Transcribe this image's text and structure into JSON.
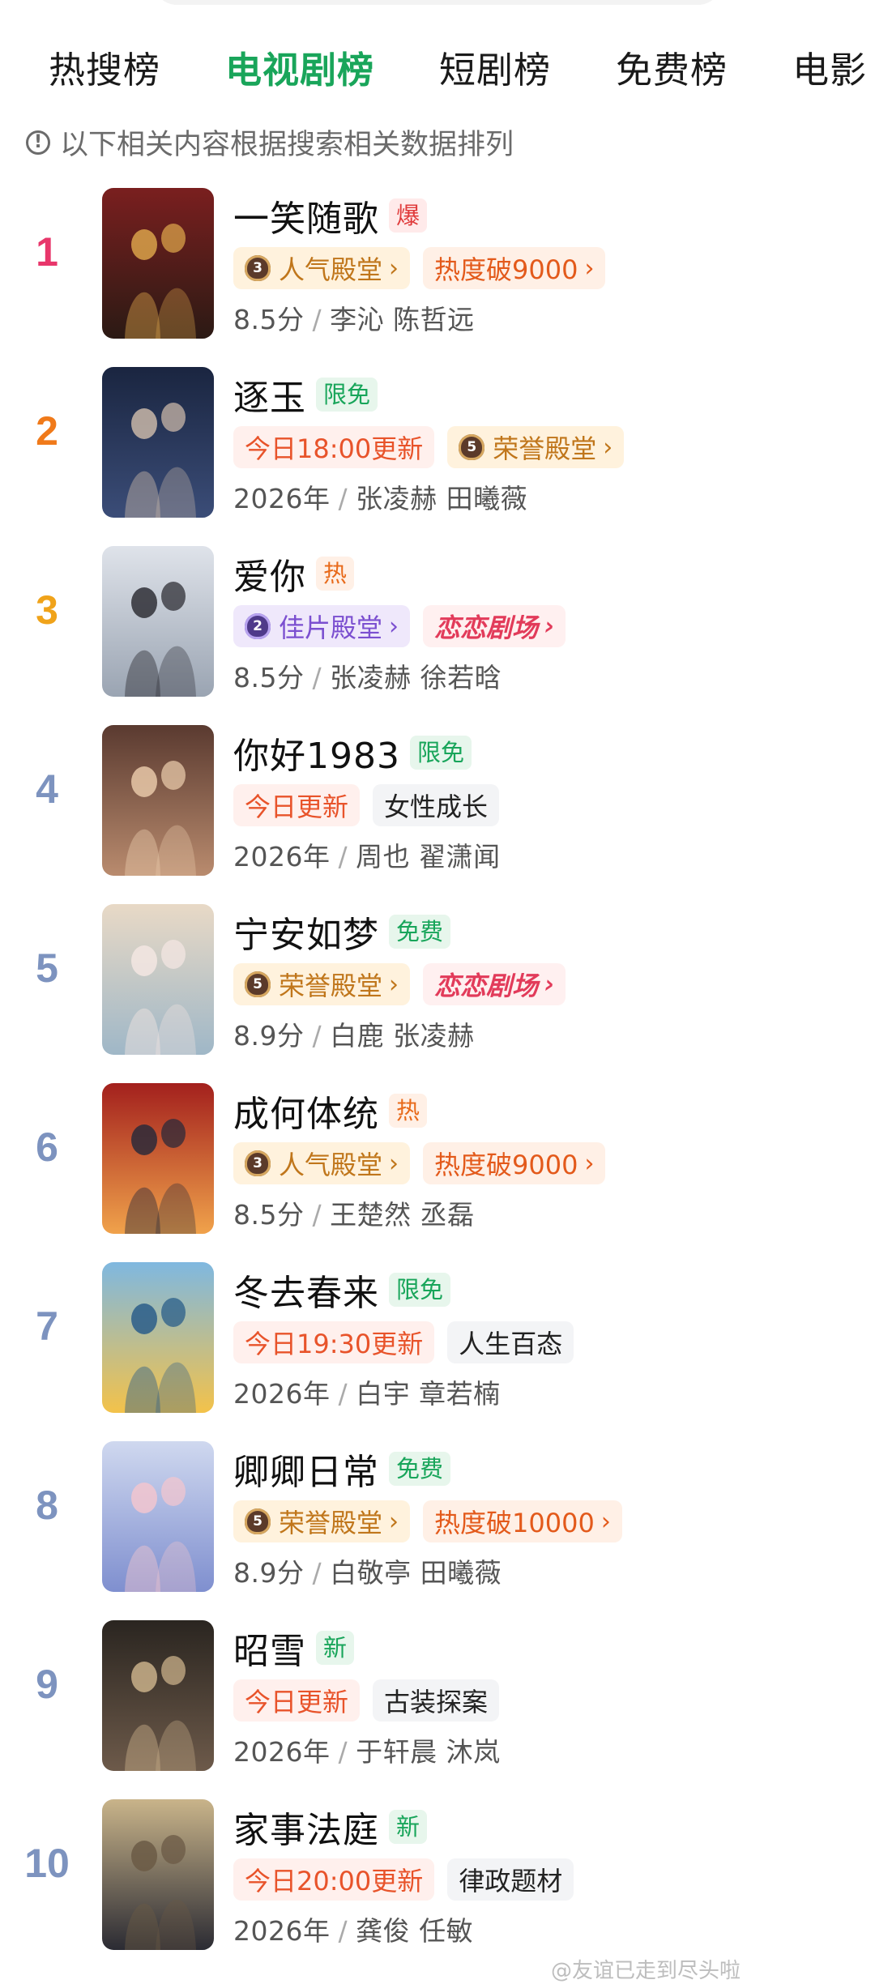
{
  "tabs": [
    "热搜榜",
    "电视剧榜",
    "短剧榜",
    "免费榜",
    "电影"
  ],
  "active_tab": 1,
  "notice": "以下相关内容根据搜索相关数据排列",
  "items": [
    {
      "rank": "1",
      "title": "一笑随歌",
      "badge": "爆",
      "badge_style": "red",
      "tags": [
        {
          "style": "gold",
          "medal": "3",
          "text": "人气殿堂",
          "chev": "›"
        },
        {
          "style": "heat",
          "text": "热度破9000",
          "chev": "›"
        }
      ],
      "meta_left": "8.5分",
      "meta_sep": "/",
      "meta_right": "李沁 陈哲远"
    },
    {
      "rank": "2",
      "title": "逐玉",
      "badge": "限免",
      "badge_style": "green",
      "tags": [
        {
          "style": "update",
          "text": "今日18:00更新"
        },
        {
          "style": "gold",
          "medal": "5",
          "text": "荣誉殿堂",
          "chev": "›"
        }
      ],
      "meta_left": "2026年",
      "meta_sep": "/",
      "meta_right": "张凌赫 田曦薇"
    },
    {
      "rank": "3",
      "title": "爱你",
      "badge": "热",
      "badge_style": "orange",
      "tags": [
        {
          "style": "purple",
          "medal": "2",
          "text": "佳片殿堂",
          "chev": "›"
        },
        {
          "style": "logo",
          "text": "恋恋剧场",
          "chev": "›"
        }
      ],
      "meta_left": "8.5分",
      "meta_sep": "/",
      "meta_right": "张凌赫 徐若晗"
    },
    {
      "rank": "4",
      "title": "你好1983",
      "badge": "限免",
      "badge_style": "green",
      "tags": [
        {
          "style": "update",
          "text": "今日更新"
        },
        {
          "style": "plain",
          "text": "女性成长"
        }
      ],
      "meta_left": "2026年",
      "meta_sep": "/",
      "meta_right": "周也 翟潇闻"
    },
    {
      "rank": "5",
      "title": "宁安如梦",
      "badge": "免费",
      "badge_style": "green",
      "tags": [
        {
          "style": "gold",
          "medal": "5",
          "text": "荣誉殿堂",
          "chev": "›"
        },
        {
          "style": "logo",
          "text": "恋恋剧场",
          "chev": "›"
        }
      ],
      "meta_left": "8.9分",
      "meta_sep": "/",
      "meta_right": "白鹿 张凌赫"
    },
    {
      "rank": "6",
      "title": "成何体统",
      "badge": "热",
      "badge_style": "orange",
      "tags": [
        {
          "style": "gold",
          "medal": "3",
          "text": "人气殿堂",
          "chev": "›"
        },
        {
          "style": "heat",
          "text": "热度破9000",
          "chev": "›"
        }
      ],
      "meta_left": "8.5分",
      "meta_sep": "/",
      "meta_right": "王楚然 丞磊"
    },
    {
      "rank": "7",
      "title": "冬去春来",
      "badge": "限免",
      "badge_style": "green",
      "tags": [
        {
          "style": "update",
          "text": "今日19:30更新"
        },
        {
          "style": "plain",
          "text": "人生百态"
        }
      ],
      "meta_left": "2026年",
      "meta_sep": "/",
      "meta_right": "白宇 章若楠"
    },
    {
      "rank": "8",
      "title": "卿卿日常",
      "badge": "免费",
      "badge_style": "green",
      "tags": [
        {
          "style": "gold",
          "medal": "5",
          "text": "荣誉殿堂",
          "chev": "›"
        },
        {
          "style": "heat",
          "text": "热度破10000",
          "chev": "›"
        }
      ],
      "meta_left": "8.9分",
      "meta_sep": "/",
      "meta_right": "白敬亭 田曦薇"
    },
    {
      "rank": "9",
      "title": "昭雪",
      "badge": "新",
      "badge_style": "green",
      "tags": [
        {
          "style": "update",
          "text": "今日更新"
        },
        {
          "style": "plain",
          "text": "古装探案"
        }
      ],
      "meta_left": "2026年",
      "meta_sep": "/",
      "meta_right": "于轩晨 沐岚"
    },
    {
      "rank": "10",
      "title": "家事法庭",
      "badge": "新",
      "badge_style": "green",
      "tags": [
        {
          "style": "update",
          "text": "今日20:00更新"
        },
        {
          "style": "plain",
          "text": "律政题材"
        }
      ],
      "meta_left": "2026年",
      "meta_sep": "/",
      "meta_right": "龚俊 任敏"
    }
  ],
  "watermark": "@友谊已走到尽头啦",
  "colors": {
    "active_tab": "#19a55a",
    "rank_1": "#e8366b",
    "rank_2": "#f07a1a",
    "rank_3": "#f0a31a",
    "rank_other": "#7d93bf"
  },
  "posters": [
    [
      "#7a1f1f",
      "#2b1a14",
      "#d9a24a"
    ],
    [
      "#1a2540",
      "#3b4d78",
      "#c9b7a8"
    ],
    [
      "#dfe3ea",
      "#9aa4b2",
      "#2f2f36"
    ],
    [
      "#5a3a30",
      "#b98b6e",
      "#e7c8a8"
    ],
    [
      "#e8d9c6",
      "#9fb7c7",
      "#f3e6e2"
    ],
    [
      "#a3201d",
      "#f0a24b",
      "#2c2a3a"
    ],
    [
      "#7fb8e0",
      "#f3c24a",
      "#2a5d8a"
    ],
    [
      "#cfd8ef",
      "#7f8fcf",
      "#f2c6cf"
    ],
    [
      "#2a2520",
      "#6d5a4a",
      "#c9b08a"
    ],
    [
      "#c9b48a",
      "#2b2b33",
      "#6b5a45"
    ]
  ]
}
